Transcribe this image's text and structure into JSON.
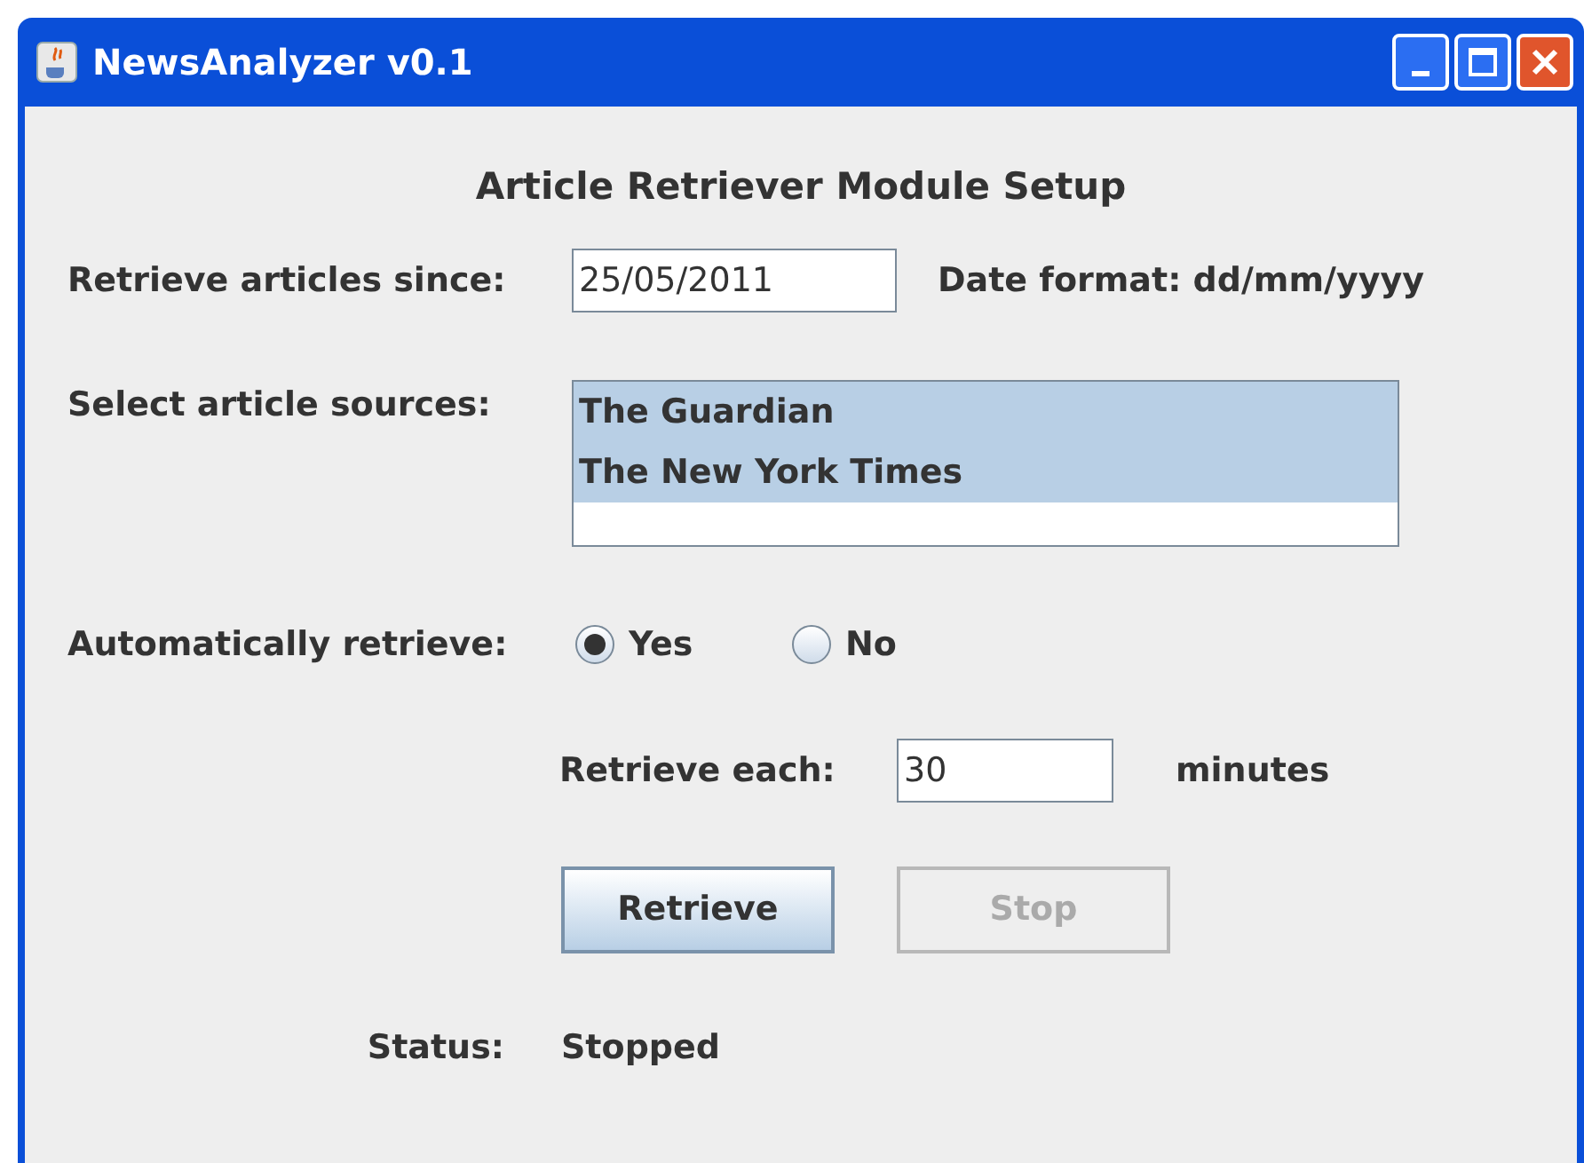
{
  "window": {
    "title": "NewsAnalyzer v0.1"
  },
  "heading": "Article Retriever Module Setup",
  "since": {
    "label": "Retrieve articles since:",
    "value": "25/05/2011",
    "hint": "Date format: dd/mm/yyyy"
  },
  "sources": {
    "label": "Select article sources:",
    "items": [
      {
        "text": "The Guardian",
        "selected": true
      },
      {
        "text": "The New York Times",
        "selected": true
      }
    ]
  },
  "auto": {
    "label": "Automatically retrieve:",
    "options": [
      {
        "text": "Yes",
        "selected": true
      },
      {
        "text": "No",
        "selected": false
      }
    ]
  },
  "interval": {
    "label": "Retrieve each:",
    "value": "30",
    "unit": "minutes"
  },
  "buttons": [
    {
      "text": "Retrieve",
      "disabled": false
    },
    {
      "text": "Stop",
      "disabled": true
    }
  ],
  "status": {
    "label": "Status:",
    "value": "Stopped"
  }
}
